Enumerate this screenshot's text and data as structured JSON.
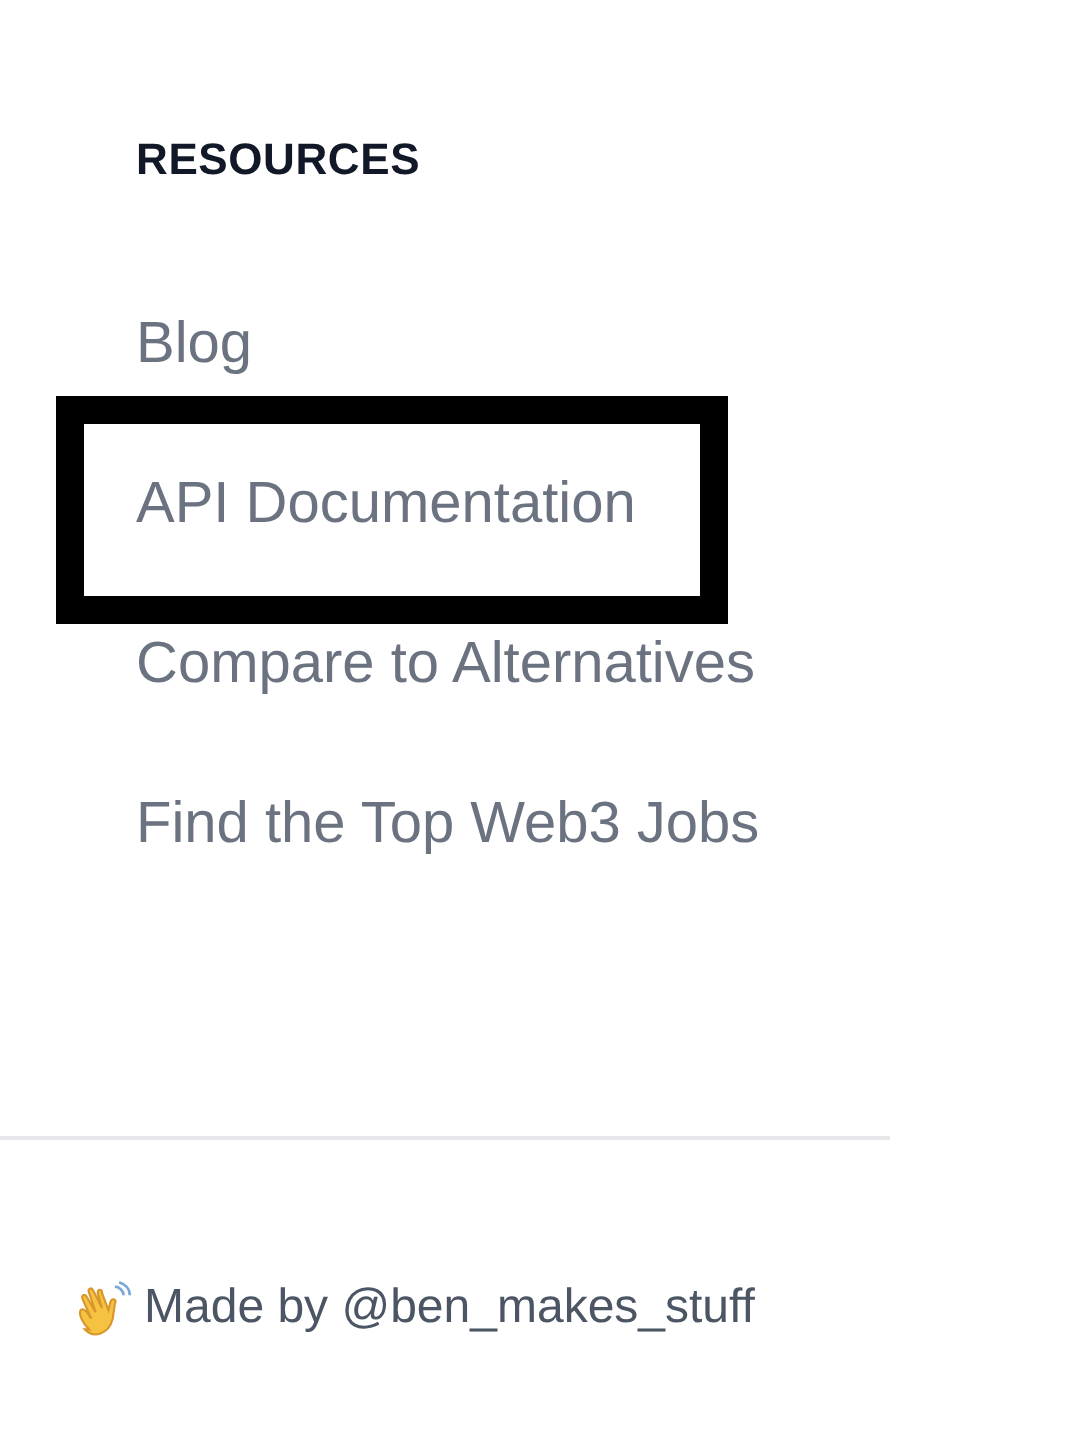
{
  "resources": {
    "heading": "RESOURCES",
    "links": [
      {
        "label": "Blog",
        "highlighted": false
      },
      {
        "label": "API Documentation",
        "highlighted": true
      },
      {
        "label": "Compare to Alternatives",
        "highlighted": false
      },
      {
        "label": "Find the Top Web3 Jobs",
        "highlighted": false
      }
    ]
  },
  "footer": {
    "credit": "Made by @ben_makes_stuff"
  }
}
